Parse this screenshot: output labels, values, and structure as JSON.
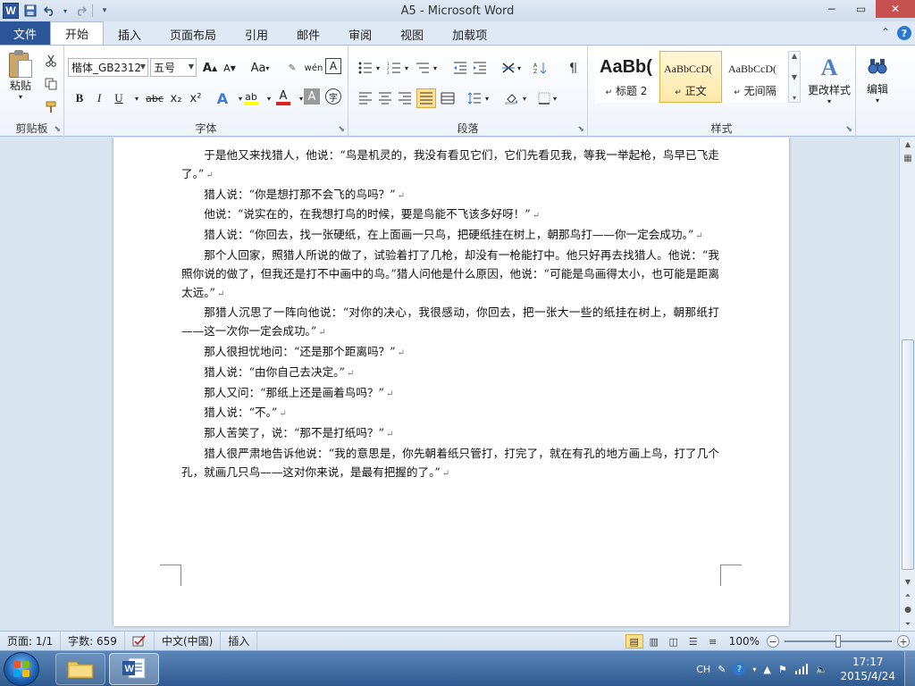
{
  "titlebar": {
    "app_logo": "W",
    "title": "A5 - Microsoft Word",
    "minimize": "−",
    "restore": "▭",
    "close": "✕"
  },
  "tabs": {
    "file": "文件",
    "items": [
      "开始",
      "插入",
      "页面布局",
      "引用",
      "邮件",
      "审阅",
      "视图",
      "加载项"
    ],
    "active_index": 0
  },
  "ribbon": {
    "clipboard": {
      "label": "剪贴板",
      "paste": "粘贴"
    },
    "font": {
      "label": "字体",
      "font_name": "楷体_GB2312",
      "font_size": "五号",
      "grow": "A",
      "shrink": "A",
      "change_case": "Aa",
      "bold": "B",
      "italic": "I",
      "underline": "U",
      "strikethrough": "abc",
      "subscript": "x₂",
      "superscript": "x²",
      "text_effects": "A",
      "highlight": "ab",
      "font_color": "A",
      "char_shading": "A",
      "enclose": "字",
      "phonetic": "wén",
      "border": "A"
    },
    "paragraph": {
      "label": "段落"
    },
    "styles": {
      "label": "样式",
      "items": [
        {
          "sample": "AaBb(",
          "name": "标题 2"
        },
        {
          "sample": "AaBbCcD(",
          "name": "正文"
        },
        {
          "sample": "AaBbCcD(",
          "name": "无间隔"
        }
      ],
      "selected_index": 1,
      "change_styles": "更改样式"
    },
    "editing": {
      "label": "编辑"
    }
  },
  "document": {
    "paragraphs": [
      {
        "text": "于是他又来找猎人，他说：“鸟是机灵的，我没有看见它们，它们先看见我，等我一举起枪，鸟早已飞走了。”",
        "indent": true
      },
      {
        "text": "猎人说：“你是想打那不会飞的鸟吗？”",
        "indent": true
      },
      {
        "text": "他说：“说实在的，在我想打鸟的时候，要是鸟能不飞该多好呀！”",
        "indent": true
      },
      {
        "text": "猎人说：“你回去，找一张硬纸，在上面画一只鸟，把硬纸挂在树上，朝那鸟打——你一定会成功。”",
        "indent": true
      },
      {
        "text": "那个人回家，照猎人所说的做了，试验着打了几枪，却没有一枪能打中。他只好再去找猎人。他说：“我照你说的做了，但我还是打不中画中的鸟。”猎人问他是什么原因，他说：“可能是鸟画得太小，也可能是距离太远。”",
        "indent": true
      },
      {
        "text": "那猎人沉思了一阵向他说：“对你的决心，我很感动，你回去，把一张大一些的纸挂在树上，朝那纸打——这一次你一定会成功。”",
        "indent": true
      },
      {
        "text": "那人很担忧地问：“还是那个距离吗？”",
        "indent": true
      },
      {
        "text": "猎人说：“由你自己去决定。”",
        "indent": true
      },
      {
        "text": "那人又问：“那纸上还是画着鸟吗？”",
        "indent": true
      },
      {
        "text": "猎人说：“不。”",
        "indent": true
      },
      {
        "text": "那人苦笑了，说：“那不是打纸吗？”",
        "indent": true
      },
      {
        "text": "猎人很严肃地告诉他说：“我的意思是，你先朝着纸只管打，打完了，就在有孔的地方画上鸟，打了几个孔，就画几只鸟——这对你来说，是最有把握的了。”",
        "indent": true
      }
    ],
    "para_mark": "↵"
  },
  "statusbar": {
    "page": "页面: 1/1",
    "words": "字数: 659",
    "language": "中文(中国)",
    "mode": "插入",
    "zoom": "100%",
    "zoom_minus": "−",
    "zoom_plus": "+",
    "zoom_fraction": 0.5
  },
  "taskbar": {
    "ime": "CH",
    "time": "17:17",
    "date": "2015/4/24"
  },
  "colors": {
    "file_tab": "#2b579a",
    "style_selected": "#ffe9a8",
    "taskbar": "#2f5a8f"
  }
}
